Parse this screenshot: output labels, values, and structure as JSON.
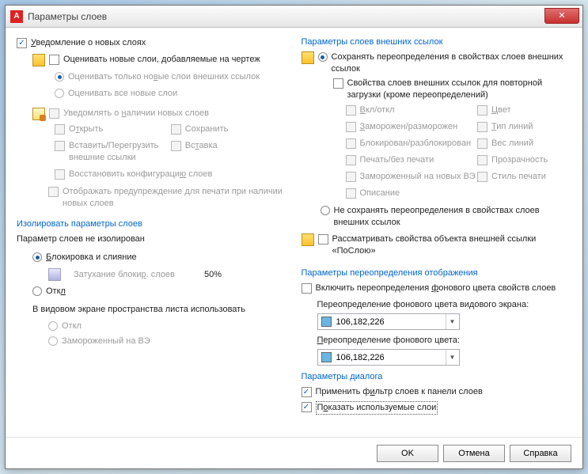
{
  "title": "Параметры слоев",
  "left": {
    "notify": "Уведомление о новых слоях",
    "evaluate": "Оценивать новые слои, добавляемые на чертеж",
    "eval_xref": "Оценивать только новые слои внешних ссылок",
    "eval_all": "Оценивать все новые слои",
    "notify_presence": "Уведомлять о наличии новых слоев",
    "open": "Открыть",
    "save": "Сохранить",
    "insert_reload": "Вставить/Перегрузить внешние ссылки",
    "insert": "Вставка",
    "restore_config": "Восстановить конфигурацию слоев",
    "show_print_warn": "Отображать предупреждение для печати при наличии новых слоев",
    "isolate_title": "Изолировать параметры слоев",
    "not_isolated": "Параметр слоев не изолирован",
    "lock_merge": "Блокировка и слияние",
    "fade_lock": "Затухание блокир. слоев",
    "fade_pct": "50%",
    "off": "Откл",
    "paperspace": "В видовом экране пространства листа использовать",
    "off2": "Откл",
    "frozen_vp": "Замороженный на ВЭ"
  },
  "right": {
    "xref_title": "Параметры слоев внешних ссылок",
    "save_override": "Сохранять переопределения в свойствах слоев внешних ссылок",
    "reload_props": "Свойства слоев внешних ссылок для повторной загрузки (кроме переопределений)",
    "onoff": "Вкл/откл",
    "color": "Цвет",
    "frozen": "Заморожен/разморожен",
    "linetype": "Тип линий",
    "locked": "Блокирован/разблокирован",
    "lineweight": "Вес линий",
    "plot": "Печать/без печати",
    "trans": "Прозрачность",
    "frozen_new": "Замороженный на новых ВЭ",
    "plotstyle": "Стиль печати",
    "desc": "Описание",
    "no_save_override": "Не сохранять переопределения в свойствах слоев внешних ссылок",
    "treat_bylayer": "Рассматривать свойства объекта внешней ссылки «ПоСлою»",
    "override_disp_title": "Параметры переопределения отображения",
    "enable_bg_override": "Включить переопределения фонового цвета свойств слоев",
    "vp_color_label": "Переопределение фонового цвета видового экрана:",
    "vp_color": "106,182,226",
    "xref_color_label": "Переопределение фонового цвета:",
    "xref_color": "106,182,226",
    "dlg_title": "Параметры диалога",
    "apply_filter": "Применить фильтр слоев к панели слоев",
    "show_used": "Показать используемые слои"
  },
  "buttons": {
    "ok": "OK",
    "cancel": "Отмена",
    "help": "Справка"
  }
}
